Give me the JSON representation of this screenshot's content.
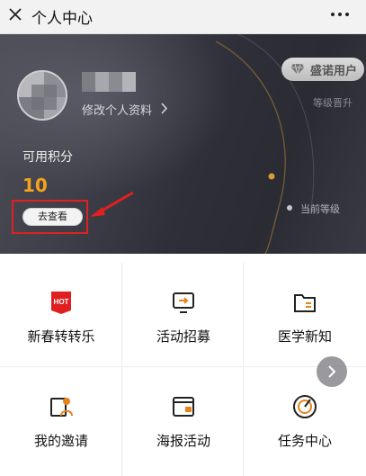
{
  "topbar": {
    "title": "个人中心",
    "close_icon": "close-icon",
    "more_icon": "more-icon"
  },
  "profile": {
    "edit_label": "修改个人资料",
    "badge_label": "盛诺用户",
    "level_up_label": "等级晋升",
    "current_level_label": "当前等级",
    "points_label": "可用积分",
    "points_value": "10",
    "view_button_label": "去查看"
  },
  "grid": {
    "items": [
      {
        "label": "新春转转乐",
        "icon": "hot-badge-icon"
      },
      {
        "label": "活动招募",
        "icon": "recruit-icon"
      },
      {
        "label": "医学新知",
        "icon": "folder-icon"
      },
      {
        "label": "我的邀请",
        "icon": "invite-icon"
      },
      {
        "label": "海报活动",
        "icon": "poster-icon"
      },
      {
        "label": "任务中心",
        "icon": "task-target-icon"
      }
    ],
    "hot_text": "HOT"
  },
  "colors": {
    "accent": "#f5a21c",
    "icon_orange": "#e8821a",
    "highlight": "#e12020"
  }
}
